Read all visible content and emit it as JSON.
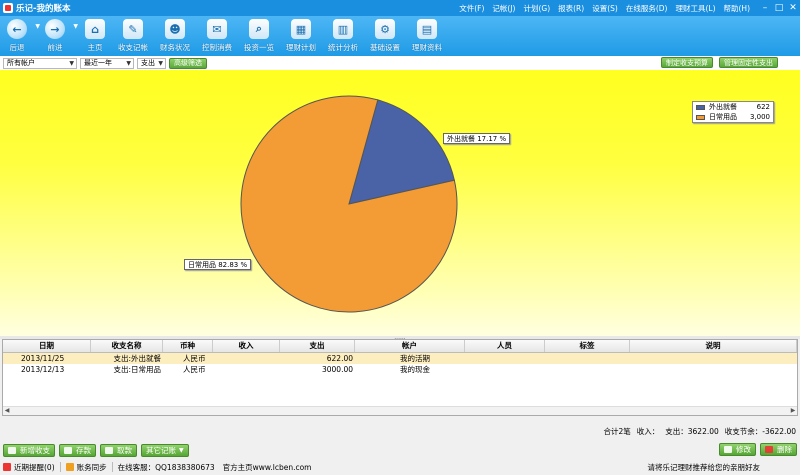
{
  "title": "乐记-我的账本",
  "menu": [
    "文件(F)",
    "记帐(J)",
    "计划(G)",
    "报表(R)",
    "设置(S)",
    "在线服务(D)",
    "理财工具(L)",
    "帮助(H)"
  ],
  "window_controls": {
    "minimize": "–",
    "maximize": "□",
    "close": "✕"
  },
  "toolbar": {
    "back": "后退",
    "forward": "前进",
    "home": "主页",
    "records": "收支记帐",
    "finance": "财务状况",
    "control": "控制消费",
    "invest": "投资一览",
    "plan": "理财计划",
    "stats": "统计分析",
    "settings": "基础设置",
    "resources": "理财资料"
  },
  "filters": {
    "account": "所有帐户",
    "period": "最近一年",
    "type": "支出",
    "advanced": "高级筛选",
    "budget": "制定收支预算",
    "fixed": "管理固定性支出"
  },
  "chart_data": {
    "type": "pie",
    "slices": [
      {
        "name": "外出就餐",
        "value": 622,
        "percent": 17.17,
        "color": "#4a63a6",
        "legend_value": "622",
        "label": "外出就餐 17.17 %"
      },
      {
        "name": "日常用品",
        "value": 3000,
        "percent": 82.83,
        "color": "#f39c36",
        "legend_value": "3,000",
        "label": "日常用品 82.83 %"
      }
    ],
    "legend_position": "top-right"
  },
  "table": {
    "columns": [
      "日期",
      "收支名称",
      "币种",
      "收入",
      "支出",
      "帐户",
      "人员",
      "标签",
      "说明"
    ],
    "rows": [
      {
        "date": "2013/11/25",
        "name": "支出:外出就餐",
        "currency": "人民币",
        "income": "",
        "expense": "622.00",
        "account": "我的活期",
        "person": "",
        "tag": "",
        "note": ""
      },
      {
        "date": "2013/12/13",
        "name": "支出:日常用品",
        "currency": "人民币",
        "income": "",
        "expense": "3000.00",
        "account": "我的现金",
        "person": "",
        "tag": "",
        "note": ""
      }
    ]
  },
  "totals": {
    "count": "合计2笔",
    "income": "收入：",
    "expense": "支出：3622.00",
    "balance": "收支节余：-3622.00"
  },
  "actions": {
    "add": "新增收支",
    "deposit": "存款",
    "withdraw": "取款",
    "other": "其它记账",
    "edit": "修改",
    "delete": "删除"
  },
  "status": {
    "reminder": "近期提醒(0)",
    "sync": "账务同步",
    "service": "在线客服：QQ1838380673",
    "site": "官方主页www.lcben.com",
    "promo": "请将乐记理财推荐给您的亲朋好友"
  }
}
